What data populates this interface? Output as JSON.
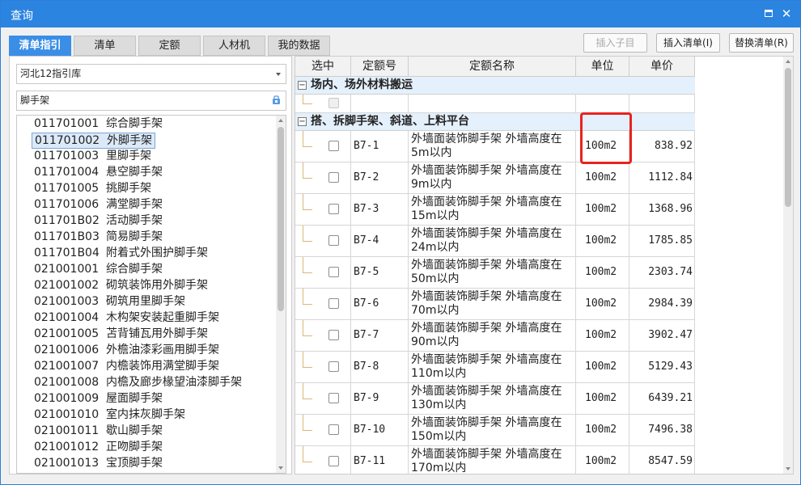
{
  "window": {
    "title": "查询"
  },
  "tabs": [
    {
      "label": "清单指引",
      "active": true
    },
    {
      "label": "清单"
    },
    {
      "label": "定额"
    },
    {
      "label": "人材机"
    },
    {
      "label": "我的数据"
    }
  ],
  "actions": {
    "insert_child": "插入子目",
    "insert_list": "插入清单(I)",
    "replace_list": "替换清单(R)"
  },
  "left": {
    "library_select": "河北12指引库",
    "search_value": "脚手架",
    "items": [
      {
        "code": "011701001",
        "name": "综合脚手架"
      },
      {
        "code": "011701002",
        "name": "外脚手架",
        "selected": true
      },
      {
        "code": "011701003",
        "name": "里脚手架"
      },
      {
        "code": "011701004",
        "name": "悬空脚手架"
      },
      {
        "code": "011701005",
        "name": "挑脚手架"
      },
      {
        "code": "011701006",
        "name": "满堂脚手架"
      },
      {
        "code": "011701B02",
        "name": "活动脚手架"
      },
      {
        "code": "011701B03",
        "name": "简易脚手架"
      },
      {
        "code": "011701B04",
        "name": "附着式外围护脚手架"
      },
      {
        "code": "021001001",
        "name": "综合脚手架"
      },
      {
        "code": "021001002",
        "name": "砌筑装饰用外脚手架"
      },
      {
        "code": "021001003",
        "name": "砌筑用里脚手架"
      },
      {
        "code": "021001004",
        "name": "木构架安装起重脚手架"
      },
      {
        "code": "021001005",
        "name": "苫背铺瓦用外脚手架"
      },
      {
        "code": "021001006",
        "name": "外檐油漆彩画用脚手架"
      },
      {
        "code": "021001007",
        "name": "内檐装饰用满堂脚手架"
      },
      {
        "code": "021001008",
        "name": "内檐及廊步椽望油漆脚手架"
      },
      {
        "code": "021001009",
        "name": "屋面脚手架"
      },
      {
        "code": "021001010",
        "name": "室内抹灰脚手架"
      },
      {
        "code": "021001011",
        "name": "歇山脚手架"
      },
      {
        "code": "021001012",
        "name": "正吻脚手架"
      },
      {
        "code": "021001013",
        "name": "宝顶脚手架"
      }
    ]
  },
  "grid": {
    "headers": {
      "select": "选中",
      "code": "定额号",
      "name": "定额名称",
      "unit": "单位",
      "price": "单价"
    },
    "groups": [
      {
        "label": "场内、场外材料搬运",
        "toggle": "−"
      },
      {
        "label": "搭、拆脚手架、斜道、上料平台",
        "toggle": "−"
      }
    ],
    "rows": [
      {
        "code": "B7-1",
        "name": "外墙面装饰脚手架 外墙高度在5m以内",
        "unit": "100m2",
        "price": "838.92"
      },
      {
        "code": "B7-2",
        "name": "外墙面装饰脚手架 外墙高度在9m以内",
        "unit": "100m2",
        "price": "1112.84"
      },
      {
        "code": "B7-3",
        "name": "外墙面装饰脚手架 外墙高度在15m以内",
        "unit": "100m2",
        "price": "1368.96"
      },
      {
        "code": "B7-4",
        "name": "外墙面装饰脚手架 外墙高度在24m以内",
        "unit": "100m2",
        "price": "1785.85"
      },
      {
        "code": "B7-5",
        "name": "外墙面装饰脚手架 外墙高度在50m以内",
        "unit": "100m2",
        "price": "2303.74"
      },
      {
        "code": "B7-6",
        "name": "外墙面装饰脚手架 外墙高度在70m以内",
        "unit": "100m2",
        "price": "2984.39"
      },
      {
        "code": "B7-7",
        "name": "外墙面装饰脚手架 外墙高度在90m以内",
        "unit": "100m2",
        "price": "3902.47"
      },
      {
        "code": "B7-8",
        "name": "外墙面装饰脚手架 外墙高度在110m以内",
        "unit": "100m2",
        "price": "5129.43"
      },
      {
        "code": "B7-9",
        "name": "外墙面装饰脚手架 外墙高度在130m以内",
        "unit": "100m2",
        "price": "6439.21"
      },
      {
        "code": "B7-10",
        "name": "外墙面装饰脚手架 外墙高度在150m以内",
        "unit": "100m2",
        "price": "7496.38"
      },
      {
        "code": "B7-11",
        "name": "外墙面装饰脚手架 外墙高度在170m以内",
        "unit": "100m2",
        "price": "8547.59"
      }
    ]
  },
  "colors": {
    "titlebar": "#2b84df",
    "active_tab": "#3a8ee6",
    "highlight": "#e8231f",
    "group_bg": "#e4f0fb"
  }
}
